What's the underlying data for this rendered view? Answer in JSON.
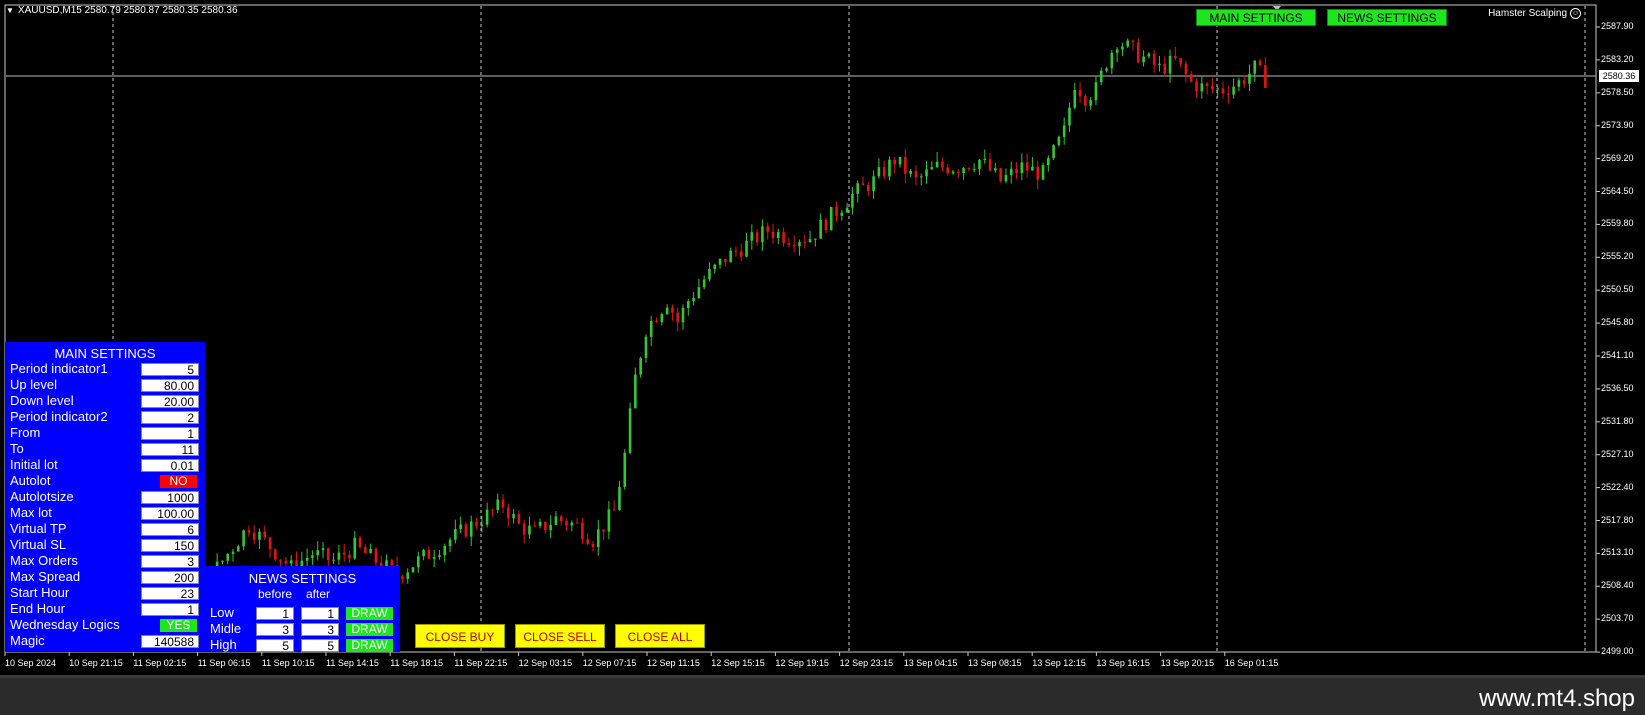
{
  "chart": {
    "symbol_header": "XAUUSD,M15  2580.79 2580.87 2580.35 2580.36",
    "indicator_name": "Hamster Scalping",
    "current_price": "2580.36",
    "price_labels": [
      "2587.90",
      "2583.20",
      "2578.50",
      "2573.90",
      "2569.20",
      "2564.50",
      "2559.80",
      "2555.20",
      "2550.50",
      "2545.80",
      "2541.10",
      "2536.50",
      "2531.80",
      "2527.10",
      "2522.40",
      "2517.80",
      "2513.10",
      "2508.40",
      "2503.70",
      "2499.00"
    ],
    "time_labels": [
      "10 Sep 2024",
      "10 Sep 21:15",
      "11 Sep 02:15",
      "11 Sep 06:15",
      "11 Sep 10:15",
      "11 Sep 14:15",
      "11 Sep 18:15",
      "11 Sep 22:15",
      "12 Sep 03:15",
      "12 Sep 07:15",
      "12 Sep 11:15",
      "12 Sep 15:15",
      "12 Sep 19:15",
      "12 Sep 23:15",
      "13 Sep 04:15",
      "13 Sep 08:15",
      "13 Sep 12:15",
      "13 Sep 16:15",
      "13 Sep 20:15",
      "16 Sep 01:15"
    ],
    "bull_color": "#32c832",
    "bear_color": "#e01414"
  },
  "chart_data": {
    "type": "candlestick",
    "y_range": [
      2499.0,
      2589.5
    ],
    "close_path": [
      [
        0,
        2524
      ],
      [
        5,
        2521
      ],
      [
        10,
        2522
      ],
      [
        14,
        2525
      ],
      [
        18,
        2527
      ],
      [
        22,
        2524
      ],
      [
        26,
        2525
      ],
      [
        30,
        2523
      ],
      [
        33,
        2516
      ],
      [
        36,
        2512
      ],
      [
        38,
        2509
      ],
      [
        42,
        2513
      ],
      [
        46,
        2517
      ],
      [
        50,
        2514
      ],
      [
        54,
        2511
      ],
      [
        58,
        2513
      ],
      [
        62,
        2512
      ],
      [
        66,
        2514
      ],
      [
        70,
        2512
      ],
      [
        74,
        2510
      ],
      [
        78,
        2512
      ],
      [
        82,
        2514
      ],
      [
        86,
        2516
      ],
      [
        90,
        2518
      ],
      [
        94,
        2520
      ],
      [
        97,
        2517
      ],
      [
        100,
        2516
      ],
      [
        104,
        2518
      ],
      [
        108,
        2517
      ],
      [
        111,
        2515
      ],
      [
        115,
        2519
      ],
      [
        117,
        2527
      ],
      [
        119,
        2538
      ],
      [
        121,
        2545
      ],
      [
        123,
        2547
      ],
      [
        125,
        2549
      ],
      [
        127,
        2546
      ],
      [
        129,
        2549
      ],
      [
        132,
        2552
      ],
      [
        136,
        2555
      ],
      [
        140,
        2557
      ],
      [
        144,
        2559
      ],
      [
        148,
        2558
      ],
      [
        152,
        2558
      ],
      [
        156,
        2561
      ],
      [
        160,
        2564
      ],
      [
        164,
        2566
      ],
      [
        168,
        2569
      ],
      [
        172,
        2566
      ],
      [
        176,
        2568
      ],
      [
        180,
        2568
      ],
      [
        184,
        2569
      ],
      [
        188,
        2566
      ],
      [
        192,
        2568
      ],
      [
        196,
        2567
      ],
      [
        200,
        2573
      ],
      [
        202,
        2580
      ],
      [
        204,
        2578
      ],
      [
        206,
        2579
      ],
      [
        208,
        2583
      ],
      [
        210,
        2586
      ],
      [
        214,
        2584
      ],
      [
        218,
        2582
      ],
      [
        221,
        2583
      ],
      [
        224,
        2580
      ],
      [
        227,
        2579
      ],
      [
        230,
        2579
      ],
      [
        233,
        2580
      ],
      [
        236,
        2582
      ],
      [
        238,
        2580.5
      ]
    ]
  },
  "top_buttons": {
    "main_settings": "MAIN SETTINGS",
    "news_settings": "NEWS SETTINGS"
  },
  "main_settings": {
    "title": "MAIN SETTINGS",
    "rows": [
      {
        "label": "Period indicator1",
        "value": "5"
      },
      {
        "label": "Up level",
        "value": "80.00"
      },
      {
        "label": "Down level",
        "value": "20.00"
      },
      {
        "label": "Period indicator2",
        "value": "2"
      },
      {
        "label": "From",
        "value": "1"
      },
      {
        "label": "To",
        "value": "11"
      },
      {
        "label": "Initial lot",
        "value": "0.01"
      },
      {
        "label": "Autolot",
        "value": "NO"
      },
      {
        "label": "Autolotsize",
        "value": "1000"
      },
      {
        "label": "Max lot",
        "value": "100.00"
      },
      {
        "label": "Virtual TP",
        "value": "6"
      },
      {
        "label": "Virtual SL",
        "value": "150"
      },
      {
        "label": "Max Orders",
        "value": "3"
      },
      {
        "label": "Max Spread",
        "value": "200"
      },
      {
        "label": "Start Hour",
        "value": "23"
      },
      {
        "label": "End Hour",
        "value": "1"
      },
      {
        "label": "Wednesday Logics",
        "value": "YES"
      },
      {
        "label": "Magic",
        "value": "140588"
      }
    ]
  },
  "news_settings": {
    "title": "NEWS SETTINGS",
    "col_before": "before",
    "col_after": "after",
    "rows": [
      {
        "label": "Low",
        "before": "1",
        "after": "1",
        "button": "DRAW"
      },
      {
        "label": "Midle",
        "before": "3",
        "after": "3",
        "button": "DRAW"
      },
      {
        "label": "High",
        "before": "5",
        "after": "5",
        "button": "DRAW"
      }
    ]
  },
  "close_buttons": {
    "close_buy": "CLOSE BUY",
    "close_sell": "CLOSE SELL",
    "close_all": "CLOSE ALL"
  },
  "toggle_colors": {
    "no": "#ff0000",
    "yes": "#1ee61e"
  },
  "footer": {
    "brand": "www.mt4.shop"
  }
}
